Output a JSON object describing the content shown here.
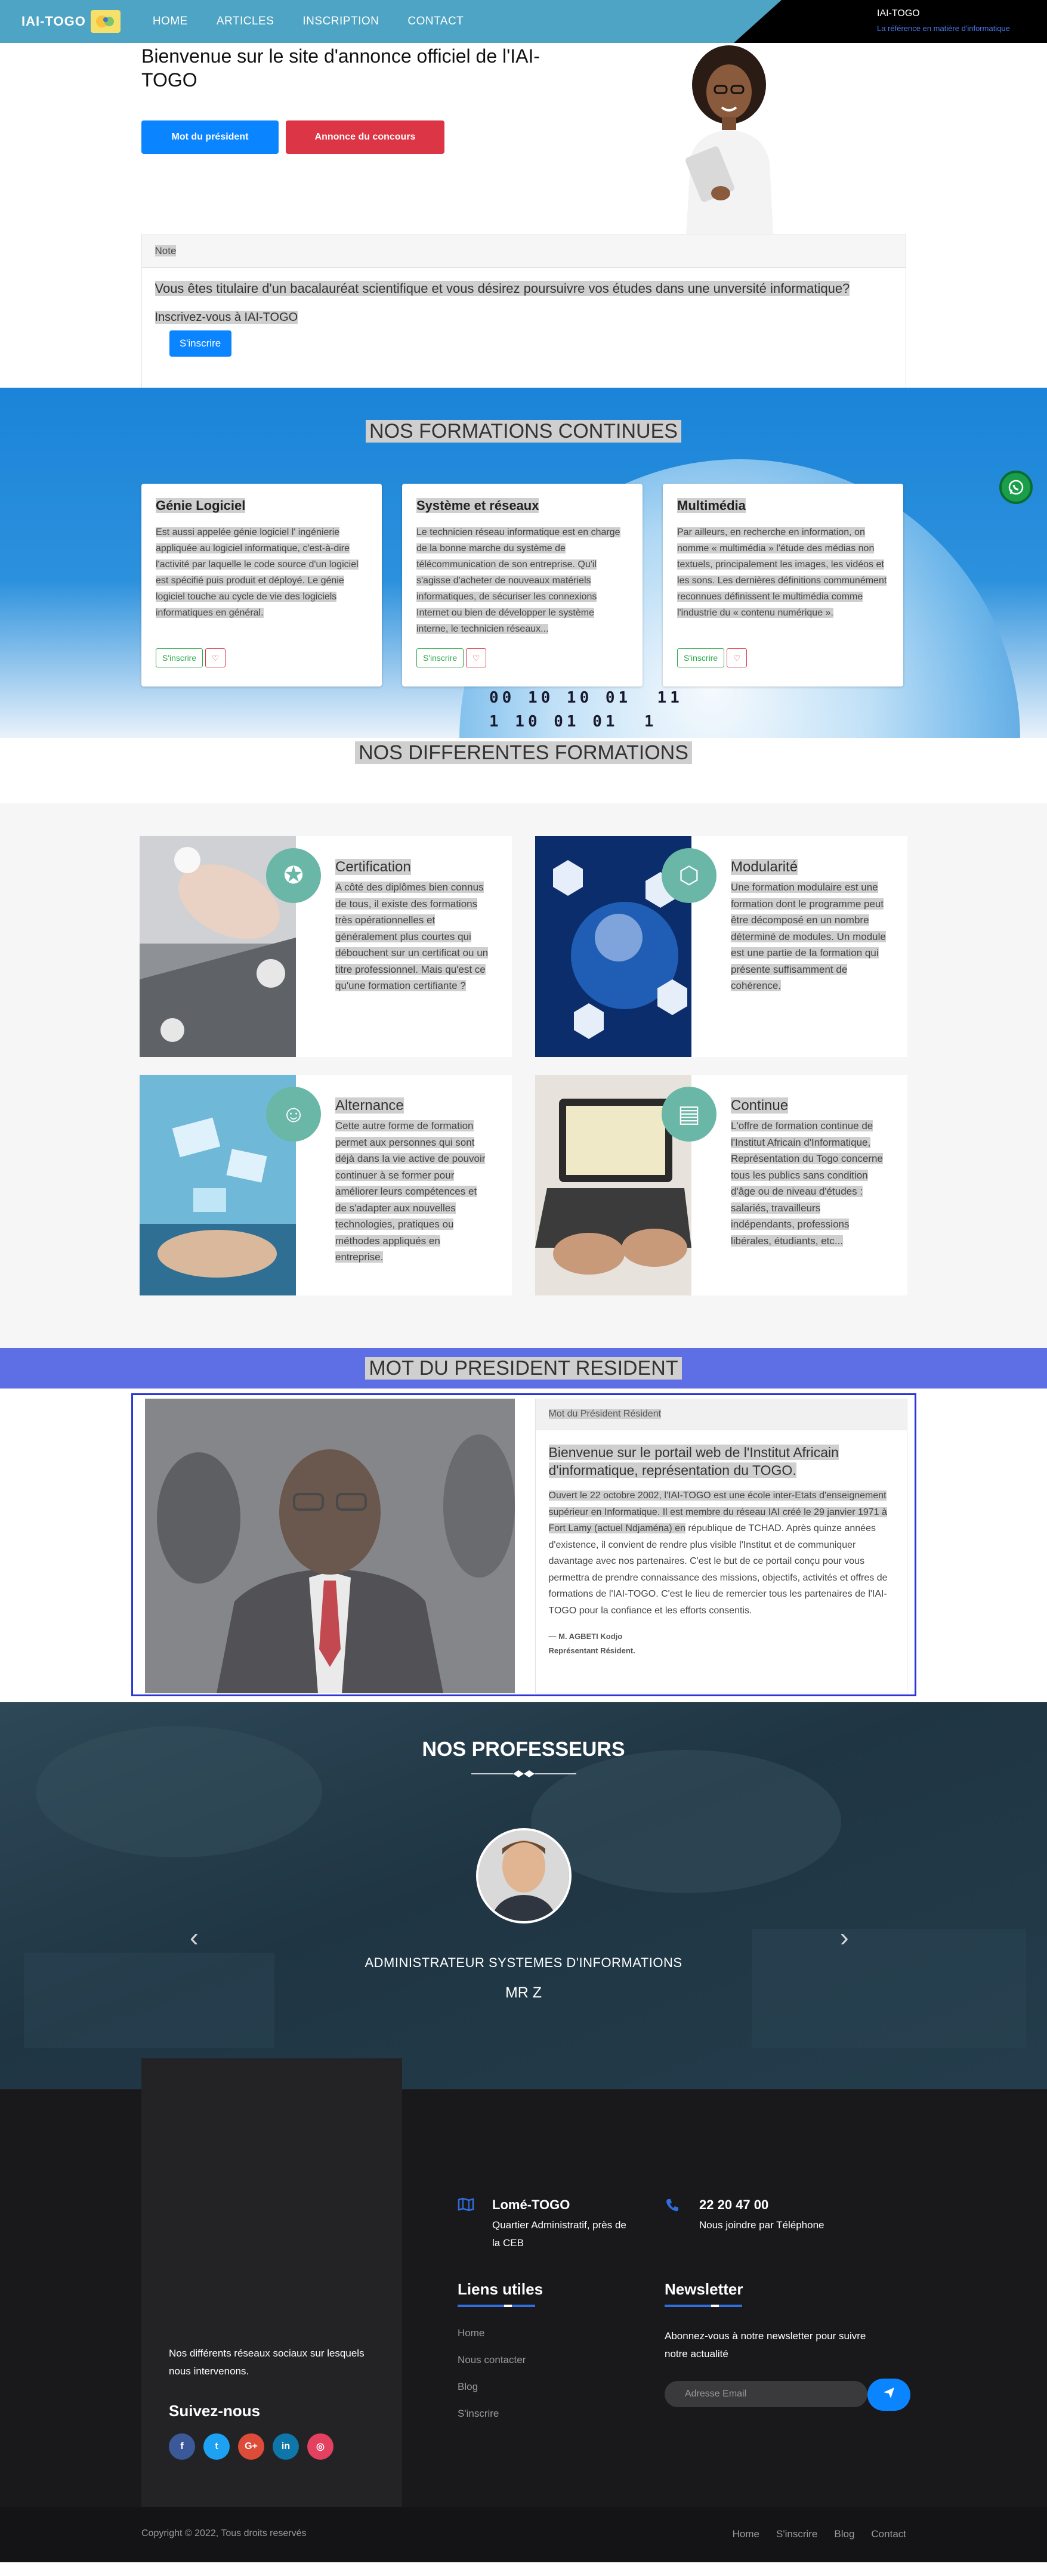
{
  "nav": {
    "brand": "IAI-TOGO",
    "links": [
      "HOME",
      "ARTICLES",
      "INSCRIPTION",
      "CONTACT"
    ],
    "right_title": "IAI-TOGO",
    "right_subtitle": "La référence en matière d'informatique"
  },
  "hero": {
    "title": "Bienvenue sur le site d'annonce officiel de l'IAI-TOGO",
    "btn_president": "Mot du président",
    "btn_concours": "Annonce du concours"
  },
  "note": {
    "header": "Note",
    "question": "Vous êtes titulaire d'un bacalauréat scientifique et vous désirez poursuivre vos études dans une unversité informatique?",
    "invite": "Inscrivez-vous à IAI-TOGO",
    "btn": "S'inscrire"
  },
  "formations_continues": {
    "title": "NOS FORMATIONS CONTINUES",
    "cards": [
      {
        "title": "Génie Logiciel",
        "text": "Est aussi appelée génie logiciel l' ingénierie appliquée au logiciel informatique, c'est-à-dire l'activité par laquelle le code source d'un logiciel est spécifié puis produit et déployé. Le génie logiciel touche au cycle de vie des logiciels informatiques en général.",
        "btn": "S'inscrire"
      },
      {
        "title": "Système et réseaux",
        "text": "Le technicien réseau informatique est en charge de la bonne marche du système de télécommunication de son entreprise. Qu'il s'agisse d'acheter de nouveaux matériels informatiques, de sécuriser les connexions Internet ou bien de développer le système interne, le technicien réseaux...",
        "btn": "S'inscrire"
      },
      {
        "title": "Multimédia",
        "text": "Par ailleurs, en recherche en information, on nomme « multimédia » l'étude des médias non textuels, principalement les images, les vidéos et les sons. Les dernières définitions communément reconnues définissent le multimédia comme l'industrie du « contenu numérique ».",
        "btn": "S'inscrire"
      }
    ],
    "binary": "00 10 10 01  11\n1 10 01 01  1\n    1 11"
  },
  "differentes_formations": {
    "title": "NOS DIFFERENTES FORMATIONS",
    "cards": [
      {
        "title": "Certification",
        "text": "A côté des diplômes bien connus de tous, il existe des formations très opérationnelles et généralement plus courtes qui débouchent sur un certificat ou un titre professionnel. Mais qu'est ce qu'une formation certifiante ?",
        "icon": "certificate-icon"
      },
      {
        "title": "Modularité",
        "text": "Une formation modulaire est une formation dont le programme peut être décomposé en un nombre déterminé de modules. Un module est une partie de la formation qui présente suffisamment de cohérence.",
        "icon": "modules-icon"
      },
      {
        "title": "Alternance",
        "text": "Cette autre forme de formation permet aux personnes qui sont déjà dans la vie active de pouvoir continuer à se former pour améliorer leurs compétences et de s'adapter aux nouvelles technologies, pratiques ou méthodes appliqués en entreprise.",
        "icon": "group-icon"
      },
      {
        "title": "Continue",
        "text": "L'offre de formation continue de l'Institut Africain d'Informatique, Représentation du Togo concerne tous les publics sans condition d'âge ou de niveau d'études : salariés, travailleurs indépendants, professions libérales, étudiants, etc...",
        "icon": "book-icon"
      }
    ]
  },
  "president": {
    "band_title": "MOT DU PRESIDENT RESIDENT",
    "card_header": "Mot du Président Résident",
    "headline": "Bienvenue sur le portail web de l'Institut Africain d'informatique, représentation du TOGO.",
    "text_highlight": "Ouvert le 22 octobre 2002, l'IAI-TOGO est une école inter-Etats d'enseignement supérieur en Informatique. Il est membre du réseau IAI créé le 29 janvier 1971 à Fort Lamy (actuel Ndjaména) en",
    "text_plain": "république de TCHAD. Après quinze années d'existence, il convient de rendre plus visible l'Institut et de communiquer davantage avec nos partenaires. C'est le but de ce portail conçu pour vous permettra de prendre connaissance des missions, objectifs, activités et offres de formations de l'IAI-TOGO. C'est le lieu de remercier tous les partenaires de l'IAI-TOGO pour la confiance et les efforts consentis.",
    "signature_name": "— M. AGBETI Kodjo",
    "signature_role": "Représentant Résident."
  },
  "professeurs": {
    "title": "NOS PROFESSEURS",
    "role": "ADMINISTRATEUR SYSTEMES D'INFORMATIONS",
    "name": "MR Z"
  },
  "footer": {
    "social_text": "Nos différents réseaux sociaux sur lesquels nous intervenons.",
    "social_title": "Suivez-nous",
    "social": [
      {
        "label": "f",
        "icon": "facebook-icon",
        "color": "#3b5998"
      },
      {
        "label": "t",
        "icon": "twitter-icon",
        "color": "#1da1f2"
      },
      {
        "label": "G+",
        "icon": "google-plus-icon",
        "color": "#dd4b39"
      },
      {
        "label": "in",
        "icon": "linkedin-icon",
        "color": "#0e76a8"
      },
      {
        "label": "◎",
        "icon": "instagram-icon",
        "color": "#e4405f"
      }
    ],
    "address_title": "Lomé-TOGO",
    "address_text": "Quartier Administratif, près de la CEB",
    "phone_title": "22 20 47 00",
    "phone_text": "Nous joindre par Téléphone",
    "links_title": "Liens utiles",
    "links": [
      "Home",
      "Nous contacter",
      "Blog",
      "S'inscrire"
    ],
    "newsletter_title": "Newsletter",
    "newsletter_text": "Abonnez-vous à notre newsletter pour suivre notre actualité",
    "newsletter_placeholder": "Adresse Email",
    "copyright": "Copyright © 2022, Tous droits reservés",
    "bottom_links": [
      "Home",
      "S'inscrire",
      "Blog",
      "Contact"
    ]
  },
  "colors": {
    "nav": "#4ea4c4",
    "primary": "#0a84ff",
    "danger": "#dc3545",
    "president_band": "#5e6fe6",
    "footer": "#19191b"
  }
}
